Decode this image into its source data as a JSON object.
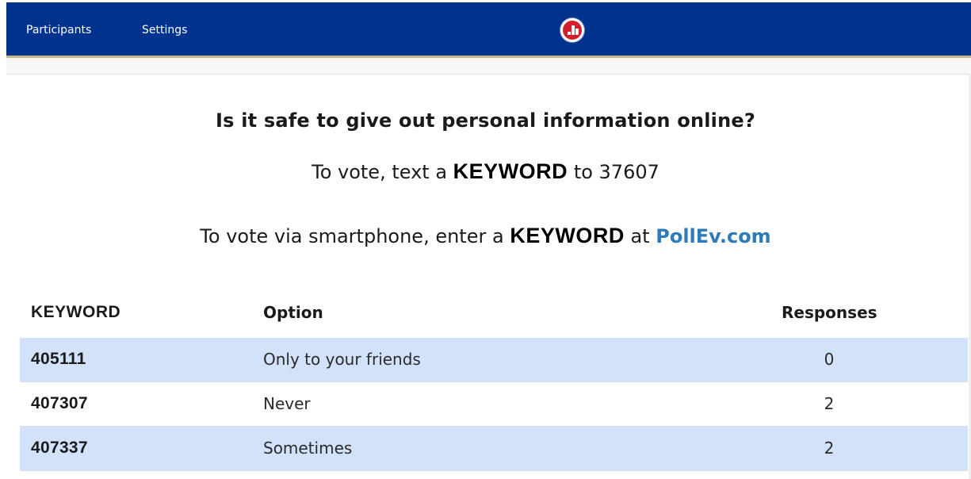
{
  "nav": {
    "participants_label": "Participants",
    "settings_label": "Settings",
    "logo_icon": "poll-everywhere-logo-icon"
  },
  "poll": {
    "question": "Is it safe to give out personal information online?",
    "text_instruction": {
      "prefix": "To vote, text a",
      "keyword": "KEYWORD",
      "suffix": "to 37607"
    },
    "web_instruction": {
      "prefix": "To vote via smartphone, enter a",
      "keyword": "KEYWORD",
      "middle": "at",
      "link": "PollEv.com"
    }
  },
  "table": {
    "headers": {
      "keyword": "KEYWORD",
      "option": "Option",
      "responses": "Responses"
    },
    "rows": [
      {
        "keyword": "405111",
        "option": "Only to your friends",
        "responses": "0"
      },
      {
        "keyword": "407307",
        "option": "Never",
        "responses": "2"
      },
      {
        "keyword": "407337",
        "option": "Sometimes",
        "responses": "2"
      }
    ]
  },
  "colors": {
    "topbar": "#00338d",
    "accent_border": "#c9b88a",
    "row_highlight": "#d3e2fb",
    "link": "#2f7ab8",
    "logo_red": "#d21f2b"
  }
}
